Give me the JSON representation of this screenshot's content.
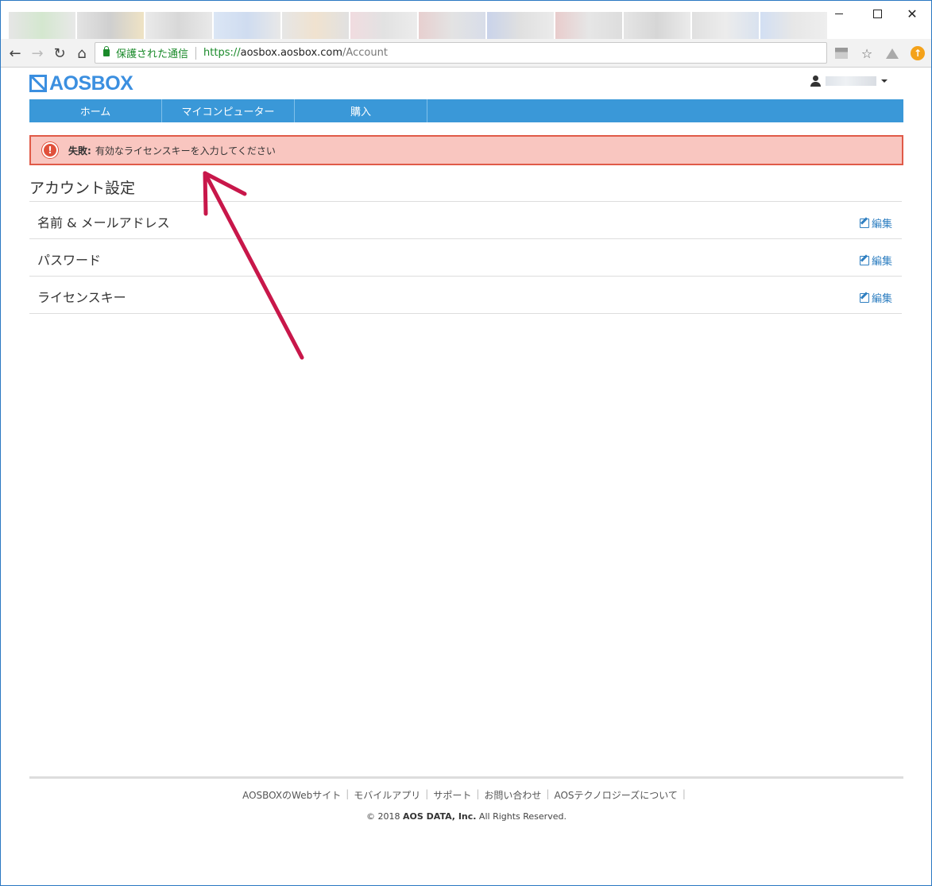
{
  "browser": {
    "secure_label": "保護された通信",
    "url_scheme": "https://",
    "url_host": "aosbox.aosbox.com",
    "url_path": "/Account"
  },
  "brand": {
    "logo_text": "AOSBOX",
    "logo_color": "#3b8fe0"
  },
  "nav": {
    "items": [
      "ホーム",
      "マイコンピューター",
      "購入"
    ],
    "color": "#3a98d8"
  },
  "alert": {
    "title": "失敗:",
    "message": "有効なライセンスキーを入力してください",
    "icon": "exclamation-icon",
    "color": "#e05a48"
  },
  "account": {
    "title": "アカウント設定",
    "rows": [
      {
        "label": "名前 & メールアドレス",
        "edit": "編集"
      },
      {
        "label": "パスワード",
        "edit": "編集"
      },
      {
        "label": "ライセンスキー",
        "edit": "編集"
      }
    ]
  },
  "footer": {
    "links": [
      "AOSBOXのWebサイト",
      "モバイルアプリ",
      "サポート",
      "お問い合わせ",
      "AOSテクノロジーズについて"
    ],
    "copyright_prefix": "© 2018 ",
    "copyright_company": "AOS DATA, Inc.",
    "copyright_suffix": " All Rights Reserved."
  },
  "annotation": {
    "arrow_color": "#c8174a"
  }
}
